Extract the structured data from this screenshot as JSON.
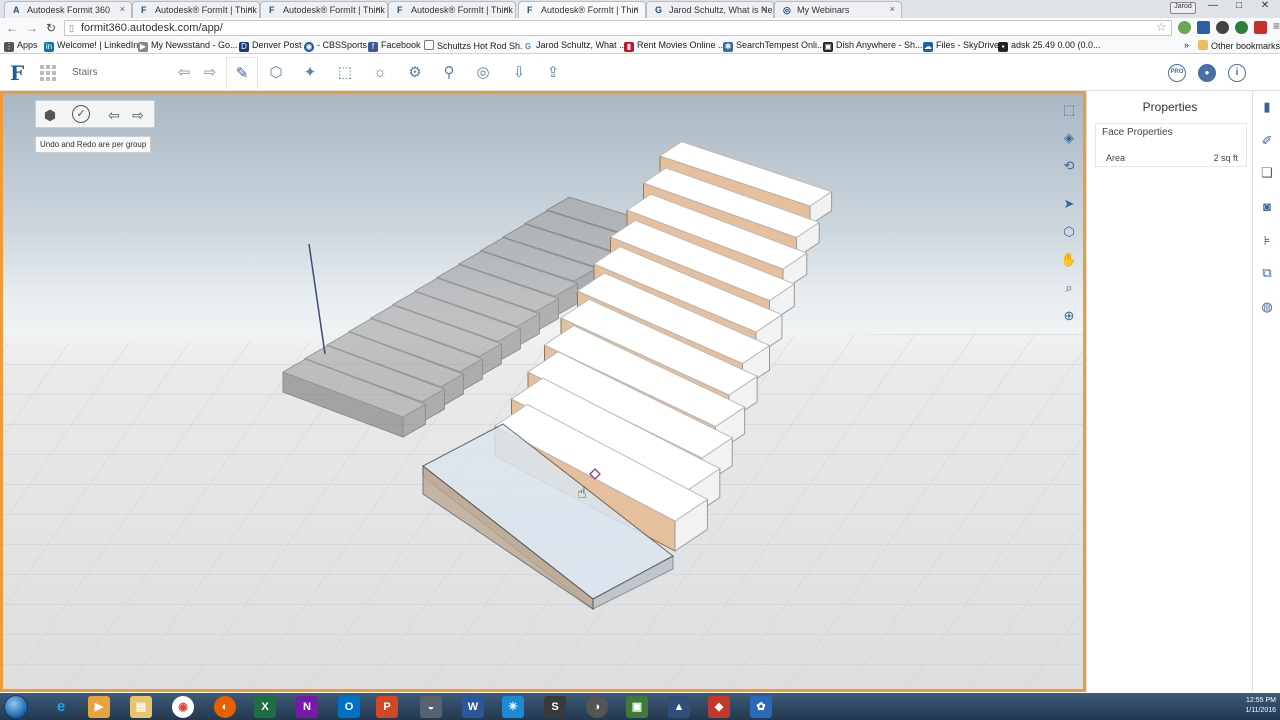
{
  "browser": {
    "tabs": [
      {
        "label": "Autodesk Formit 360",
        "active": false
      },
      {
        "label": "Autodesk® FormIt | Think",
        "active": false
      },
      {
        "label": "Autodesk® FormIt | Think",
        "active": false
      },
      {
        "label": "Autodesk® FormIt | Think",
        "active": false
      },
      {
        "label": "Autodesk® FormIt | Thin",
        "active": true
      },
      {
        "label": "Jarod Schultz, What is Ne",
        "active": false
      },
      {
        "label": "My Webinars",
        "active": false
      }
    ],
    "user_badge": "Jarod",
    "url": "formit360.autodesk.com/app/",
    "bookmarks": [
      {
        "label": "Apps",
        "icon": "apps-grid-icon"
      },
      {
        "label": "Welcome! | LinkedIn",
        "icon": "linkedin-icon"
      },
      {
        "label": "My Newsstand - Go...",
        "icon": "newsstand-icon"
      },
      {
        "label": "Denver Post",
        "icon": "denver-post-icon"
      },
      {
        "label": "- CBSSports",
        "icon": "cbs-icon"
      },
      {
        "label": "Facebook",
        "icon": "facebook-icon"
      },
      {
        "label": "Schultzs Hot Rod Sh...",
        "icon": "page-icon"
      },
      {
        "label": "Jarod Schultz, What ...",
        "icon": "google-icon"
      },
      {
        "label": "Rent Movies Online ...",
        "icon": "redbox-icon"
      },
      {
        "label": "SearchTempest Onli...",
        "icon": "searchtempest-icon"
      },
      {
        "label": "Dish Anywhere - Sh...",
        "icon": "dish-icon"
      },
      {
        "label": "Files - SkyDrive",
        "icon": "skydrive-icon"
      },
      {
        "label": "adsk 25.49 0.00 (0.0...",
        "icon": "stock-icon"
      }
    ],
    "other_bookmarks": "Other bookmarks"
  },
  "app": {
    "logo": "F",
    "breadcrumb": "Stairs",
    "undo_tooltip": "Undo and Redo are per group"
  },
  "properties": {
    "title": "Properties",
    "card_title": "Face Properties",
    "area_label": "Area",
    "area_value": "2 sq ft"
  },
  "taskbar": {
    "time": "12:55 PM",
    "date": "1/11/2016"
  },
  "colors": {
    "accent_border": "#f29a34",
    "stair_riser": "#e6c09c",
    "brand_blue": "#1d5a9e"
  }
}
